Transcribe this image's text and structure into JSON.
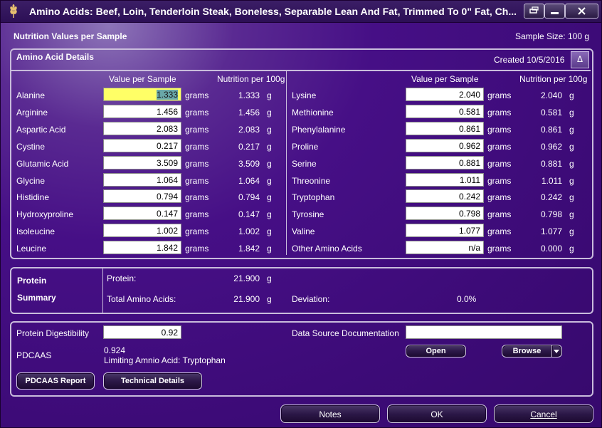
{
  "window": {
    "title": "Amino Acids: Beef, Loin, Tenderloin Steak, Boneless, Separable Lean And Fat, Trimmed To 0\" Fat, Ch...",
    "icon": "wheat-icon",
    "controls": [
      "restore-icon",
      "minimize-icon",
      "close-icon"
    ]
  },
  "header": {
    "left": "Nutrition Values per Sample",
    "right": "Sample Size: 100 g"
  },
  "details": {
    "title": "Amino Acid Details",
    "created": "Created 10/5/2016",
    "sort_symbol": "Δ",
    "col_value": "Value per Sample",
    "col_per100": "Nutrition per 100g",
    "unit_grams": "grams",
    "unit_g": "g",
    "left": [
      {
        "name": "Alanine",
        "value": "1.333",
        "per100": "1.333"
      },
      {
        "name": "Arginine",
        "value": "1.456",
        "per100": "1.456"
      },
      {
        "name": "Aspartic Acid",
        "value": "2.083",
        "per100": "2.083"
      },
      {
        "name": "Cystine",
        "value": "0.217",
        "per100": "0.217"
      },
      {
        "name": "Glutamic Acid",
        "value": "3.509",
        "per100": "3.509"
      },
      {
        "name": "Glycine",
        "value": "1.064",
        "per100": "1.064"
      },
      {
        "name": "Histidine",
        "value": "0.794",
        "per100": "0.794"
      },
      {
        "name": "Hydroxyproline",
        "value": "0.147",
        "per100": "0.147"
      },
      {
        "name": "Isoleucine",
        "value": "1.002",
        "per100": "1.002"
      },
      {
        "name": "Leucine",
        "value": "1.842",
        "per100": "1.842"
      }
    ],
    "right": [
      {
        "name": "Lysine",
        "value": "2.040",
        "per100": "2.040"
      },
      {
        "name": "Methionine",
        "value": "0.581",
        "per100": "0.581"
      },
      {
        "name": "Phenylalanine",
        "value": "0.861",
        "per100": "0.861"
      },
      {
        "name": "Proline",
        "value": "0.962",
        "per100": "0.962"
      },
      {
        "name": "Serine",
        "value": "0.881",
        "per100": "0.881"
      },
      {
        "name": "Threonine",
        "value": "1.011",
        "per100": "1.011"
      },
      {
        "name": "Tryptophan",
        "value": "0.242",
        "per100": "0.242"
      },
      {
        "name": "Tyrosine",
        "value": "0.798",
        "per100": "0.798"
      },
      {
        "name": "Valine",
        "value": "1.077",
        "per100": "1.077"
      },
      {
        "name": "Other Amino Acids",
        "value": "n/a",
        "per100": "0.000"
      }
    ]
  },
  "summary": {
    "title_line1": "Protein",
    "title_line2": "Summary",
    "protein_label": "Protein:",
    "protein_value": "21.900",
    "total_label": "Total Amino Acids:",
    "total_value": "21.900",
    "unit": "g",
    "deviation_label": "Deviation:",
    "deviation_value": "0.0%"
  },
  "bottom": {
    "digestibility_label": "Protein Digestibility",
    "digestibility_value": "0.92",
    "pdcaas_label": "PDCAAS",
    "pdcaas_value": "0.924",
    "limiting": "Limiting Amnio Acid: Tryptophan",
    "datasource_label": "Data Source Documentation",
    "datasource_value": "",
    "open_label": "Open",
    "browse_label": "Browse",
    "report_label": "PDCAAS Report",
    "technical_label": "Technical Details"
  },
  "footer": {
    "notes_label": "Notes",
    "ok_label": "OK",
    "cancel_label": "Cancel"
  }
}
